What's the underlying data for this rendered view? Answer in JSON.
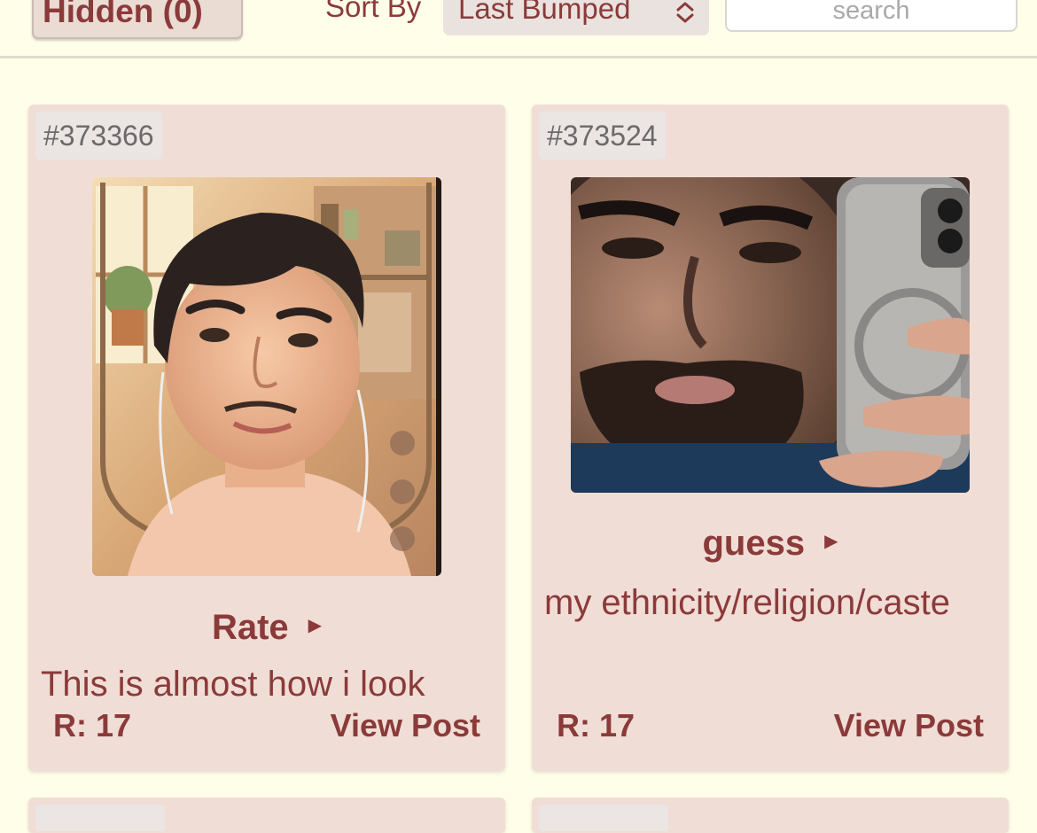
{
  "toolbar": {
    "hidden_label": "Hidden (0)",
    "sort_label": "Sort By",
    "sort_value": "Last Bumped",
    "search_placeholder": "search"
  },
  "posts": [
    {
      "id": "#373366",
      "title": "Rate",
      "body": "This is almost how i look",
      "replies": "R: 17",
      "view": "View Post"
    },
    {
      "id": "#373524",
      "title": "guess",
      "body": "my ethnicity/religion/caste",
      "replies": "R: 17",
      "view": "View Post"
    }
  ],
  "colors": {
    "background": "#fffee9",
    "card": "#f0ded6",
    "accent": "#8b3a3a",
    "id_badge": "#ebe5e3"
  },
  "icons": {
    "sort_chevron": "chevron-up-down-icon",
    "title_arrow": "triangle-right-icon"
  }
}
